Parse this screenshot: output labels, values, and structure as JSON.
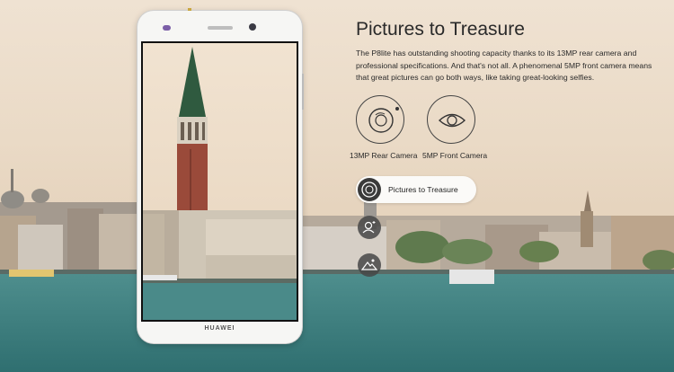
{
  "header": {
    "title": "Pictures to Treasure",
    "description": "The P8lite has outstanding shooting capacity thanks to its 13MP rear camera and professional specifications. And that's not all. A phenomenal 5MP front camera means that great pictures can go both ways, like taking great-looking selfies."
  },
  "features": [
    {
      "label": "13MP Rear Camera",
      "icon": "rear-camera-icon"
    },
    {
      "label": "5MP Front Camera",
      "icon": "eye-icon"
    }
  ],
  "menu": {
    "active": {
      "label": "Pictures to Treasure",
      "icon": "camera-lens-icon"
    },
    "items": [
      {
        "icon": "selfie-person-icon"
      },
      {
        "icon": "mountain-landscape-icon"
      }
    ]
  },
  "phone": {
    "brand": "HUAWEI"
  }
}
